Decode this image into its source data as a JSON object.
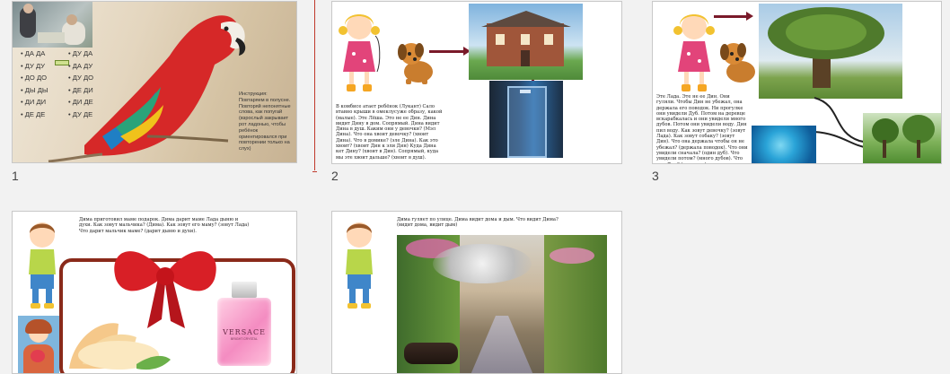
{
  "slides": [
    {
      "number": "1",
      "syllables_left": [
        "ДА ДА",
        "ДУ ДУ",
        "ДО ДО",
        "ДЫ ДЫ",
        "ДИ ДИ",
        "ДЕ ДЕ"
      ],
      "syllables_right": [
        "ДУ ДА",
        "ДА ДУ",
        "ДУ ДО",
        "ДЕ ДИ",
        "ДИ ДЕ",
        "ДУ ДЕ"
      ],
      "instruction": "Инструкция:\nПовтаряем в полусне.\nПовторяй непонятные слова, как попугай (взрослый закрывает рот ладонью, чтобы ребёнок ориентировался при повторении только на слух)"
    },
    {
      "number": "2",
      "text": "В комбисе атает ребёнок (Лукант) Сало втавно крыши в омеклусуже образу, какой (малые). Эте Лёша. Это не ее Дин. Дина видит Дину в дом. Сопрямый. Дина видит Дина в душ. Каким они у девочки? (Мэл Дина). Что она хвоит девочку? (хвоит Дина). Что в домике? (эле Дина). Как это хвоит? (хвоит Дин к эли Дин) Куда Дина кет Дину? (хвоит в Дин). Сопрямый, куда мы эте хвоит дальше? (хвоит в душ)."
    },
    {
      "number": "3",
      "text": "Эте Лада. Эте не ее Дин. Они гуляли. Чтобы Дин не убежал, она держала его поводок. Ни прогулке они увидели Дуб. Потом на деревце вскарабкалась и они увидели много дубов. Потом они увидели воду. Дин пил воду. Как зовут девочку? (зовут Лада). Как зовут собаку? (зовут Дин). Что она держала чтобы он не убежал? (держала поводок). Что они увидели сначала? (один дуб). Что увидели потом? (много дубов). Что пил Дин? (пил воду)."
    },
    {
      "number": "",
      "text": "Дима приготовил маме подарок. Дима дарит маме Лада дыню и духи. Как зовут мальчика? (Дима). Как зовут его маму? (зовут Лада) Что дарит мальчик маме? (дарит дыню и духи).",
      "perfume_brand": "VERSACE",
      "perfume_sub": "BRIGHT CRYSTAL"
    },
    {
      "number": "",
      "text": "Дима гуляет по улице. Дима видит дома и дым. Что видит Дима? (видит дома, видит дым)"
    }
  ],
  "colors": {
    "accent": "#7a1a2a",
    "parrot": "#d42a2a"
  }
}
